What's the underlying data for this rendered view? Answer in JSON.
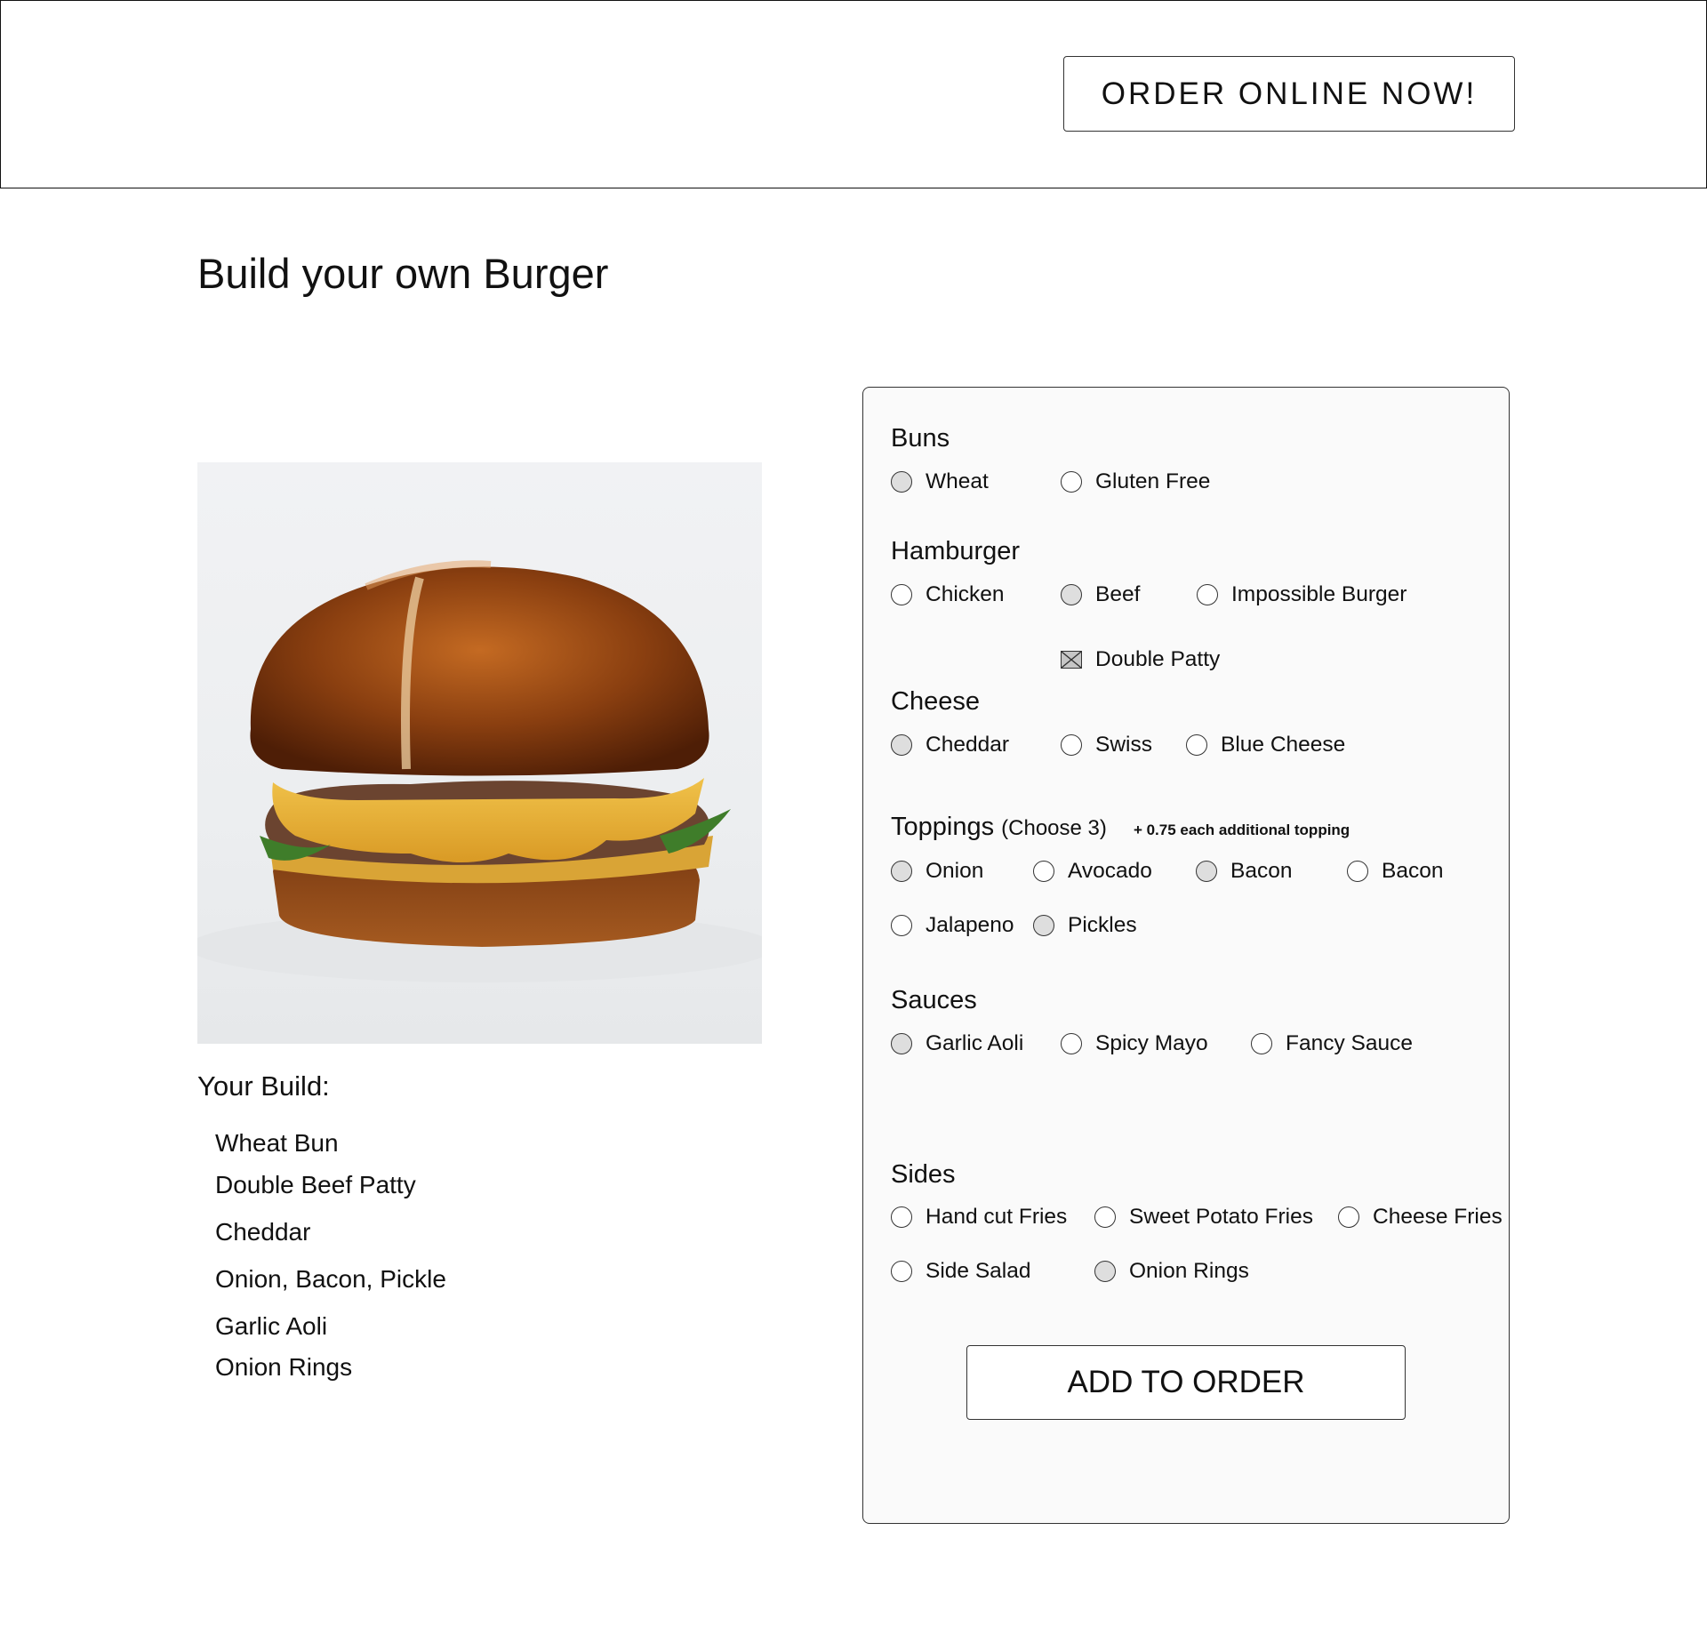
{
  "header": {
    "order_online_label": "ORDER ONLINE NOW!"
  },
  "page": {
    "title": "Build your own Burger"
  },
  "image": {
    "alt": "burger-photo"
  },
  "build": {
    "title": "Your Build:",
    "items": [
      "Wheat Bun",
      "Double Beef Patty",
      "Cheddar",
      "Onion, Bacon, Pickle",
      "Garlic Aoli",
      "Onion Rings"
    ]
  },
  "builder": {
    "buns": {
      "title": "Buns",
      "options": [
        {
          "label": "Wheat",
          "selected": true
        },
        {
          "label": "Gluten Free",
          "selected": false
        }
      ]
    },
    "hamburger": {
      "title": "Hamburger",
      "options": [
        {
          "label": "Chicken",
          "selected": false
        },
        {
          "label": "Beef",
          "selected": true
        },
        {
          "label": "Impossible Burger",
          "selected": false
        }
      ],
      "double_patty": {
        "label": "Double Patty",
        "checked": true
      }
    },
    "cheese": {
      "title": "Cheese",
      "options": [
        {
          "label": "Cheddar",
          "selected": true
        },
        {
          "label": "Swiss",
          "selected": false
        },
        {
          "label": "Blue Cheese",
          "selected": false
        }
      ]
    },
    "toppings": {
      "title": "Toppings",
      "subtitle": "(Choose 3)",
      "note": "+ 0.75 each additional topping",
      "options": [
        {
          "label": "Onion",
          "selected": true
        },
        {
          "label": "Avocado",
          "selected": false
        },
        {
          "label": "Bacon",
          "selected": true
        },
        {
          "label": "Bacon",
          "selected": false
        },
        {
          "label": "Jalapeno",
          "selected": false
        },
        {
          "label": "Pickles",
          "selected": true
        }
      ]
    },
    "sauces": {
      "title": "Sauces",
      "options": [
        {
          "label": "Garlic Aoli",
          "selected": true
        },
        {
          "label": "Spicy Mayo",
          "selected": false
        },
        {
          "label": "Fancy Sauce",
          "selected": false
        }
      ]
    },
    "sides": {
      "title": "Sides",
      "options": [
        {
          "label": "Hand cut Fries",
          "selected": false
        },
        {
          "label": "Sweet Potato Fries",
          "selected": false
        },
        {
          "label": "Cheese Fries",
          "selected": false
        },
        {
          "label": "Side Salad",
          "selected": false
        },
        {
          "label": "Onion Rings",
          "selected": true
        }
      ]
    },
    "add_label": "ADD TO ORDER"
  }
}
